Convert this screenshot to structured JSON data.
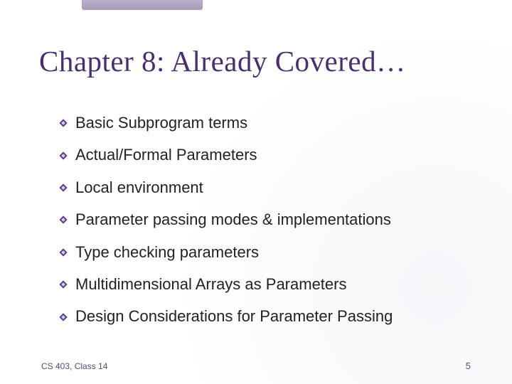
{
  "title": "Chapter 8: Already Covered…",
  "bullets": [
    "Basic Subprogram terms",
    "Actual/Formal Parameters",
    "Local environment",
    "Parameter passing modes & implementations",
    "Type checking parameters",
    "Multidimensional Arrays as Parameters",
    "Design Considerations for Parameter Passing"
  ],
  "footer_left": "CS 403, Class 14",
  "footer_right": "5",
  "bullet_color": "#5a3c8a"
}
